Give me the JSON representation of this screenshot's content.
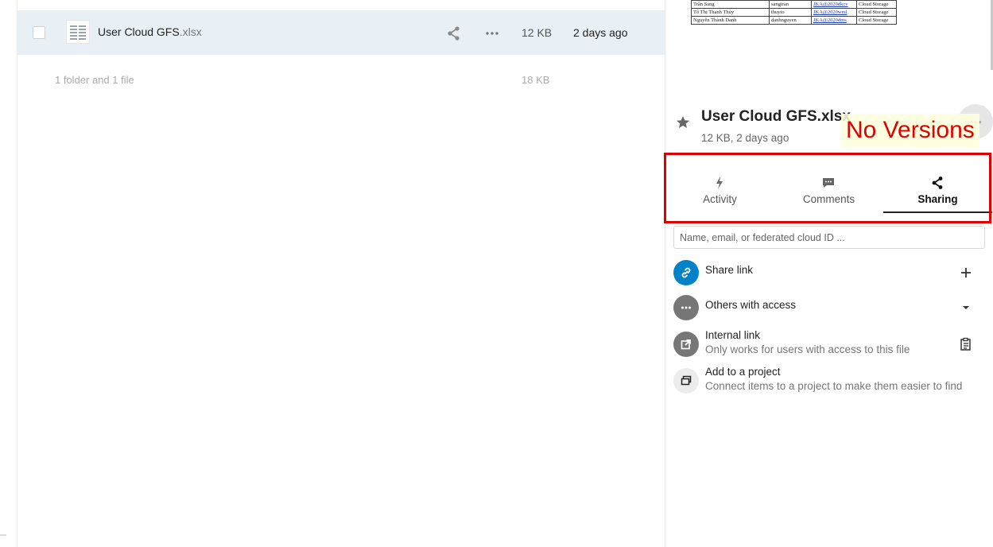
{
  "file_list": {
    "rows": [
      {
        "name": "User Cloud GFS",
        "extension": ".xlsx",
        "size": "12 KB",
        "modified": "2 days ago"
      }
    ],
    "summary": {
      "text": "1 folder and 1 file",
      "size": "18 KB"
    }
  },
  "preview": {
    "rows": [
      [
        "Trần Sang",
        "sangtran",
        "JKA@2020dkcv",
        "Cloud Storage"
      ],
      [
        "Tô Thị Thanh Thủy",
        "thuyto",
        "JKA@2020wml",
        "Cloud Storage"
      ],
      [
        "Nguyễn Thành Danh",
        "danhnguyen",
        "JKA@2020dms",
        "Cloud Storage"
      ]
    ]
  },
  "sidebar": {
    "title": "User Cloud GFS.xlsx",
    "subtitle": "12 KB, 2 days ago",
    "annotation": "No Versions",
    "tabs": [
      {
        "label": "Activity",
        "icon": "activity-bolt-icon"
      },
      {
        "label": "Comments",
        "icon": "comment-bubble-icon"
      },
      {
        "label": "Sharing",
        "icon": "share-icon",
        "active": true
      }
    ],
    "share_input_placeholder": "Name, email, or federated cloud ID ...",
    "share_link": {
      "label": "Share link",
      "icon": "link-icon",
      "action_icon": "plus-icon"
    },
    "others_with_access": {
      "label": "Others with access",
      "icon": "more-dots-icon",
      "action_icon": "caret-down-icon"
    },
    "internal_link": {
      "label": "Internal link",
      "sublabel": "Only works for users with access to this file",
      "icon": "external-link-icon",
      "action_icon": "clipboard-icon"
    },
    "add_to_project": {
      "label": "Add to a project",
      "sublabel": "Connect items to a project to make them easier to find",
      "icon": "project-icon"
    }
  },
  "colors": {
    "accent": "#0082c9",
    "annotation": "#e00000",
    "selected_row": "#e8f0f6"
  }
}
